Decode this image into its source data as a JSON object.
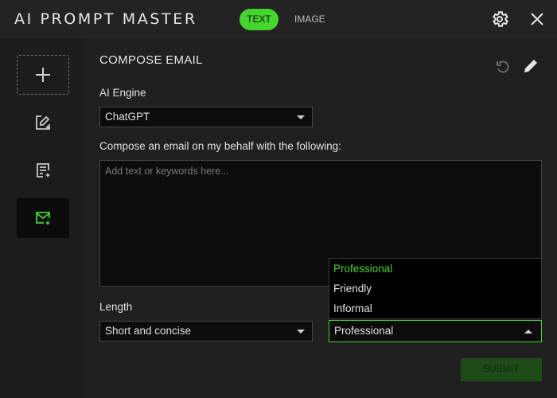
{
  "app": {
    "title": "AI PROMPT MASTER"
  },
  "tabs": [
    {
      "label": "TEXT",
      "active": true
    },
    {
      "label": "IMAGE",
      "active": false
    }
  ],
  "window_icons": [
    "gear-icon",
    "close-icon"
  ],
  "sidebar": {
    "items": [
      {
        "icon": "add-icon"
      },
      {
        "icon": "image-edit-icon"
      },
      {
        "icon": "document-edit-icon"
      },
      {
        "icon": "email-compose-icon",
        "active": true
      }
    ]
  },
  "main": {
    "heading": "COMPOSE EMAIL",
    "header_icons": [
      "undo-icon",
      "edit-pencil-icon"
    ],
    "engine": {
      "label": "AI Engine",
      "value": "ChatGPT"
    },
    "compose": {
      "label": "Compose an email on my behalf with the following:",
      "value": "",
      "placeholder": "Add text or keywords here..."
    },
    "length": {
      "label": "Length",
      "value": "Short and concise"
    },
    "tone": {
      "value": "Professional",
      "options": [
        "Professional",
        "Friendly",
        "Informal"
      ],
      "selected_index": 0,
      "open": true
    },
    "submit_label": "SUBMIT"
  },
  "colors": {
    "accent": "#44d62c",
    "background": "#1f1f1f",
    "titlebar": "#232323",
    "field": "#0c0c0c"
  }
}
